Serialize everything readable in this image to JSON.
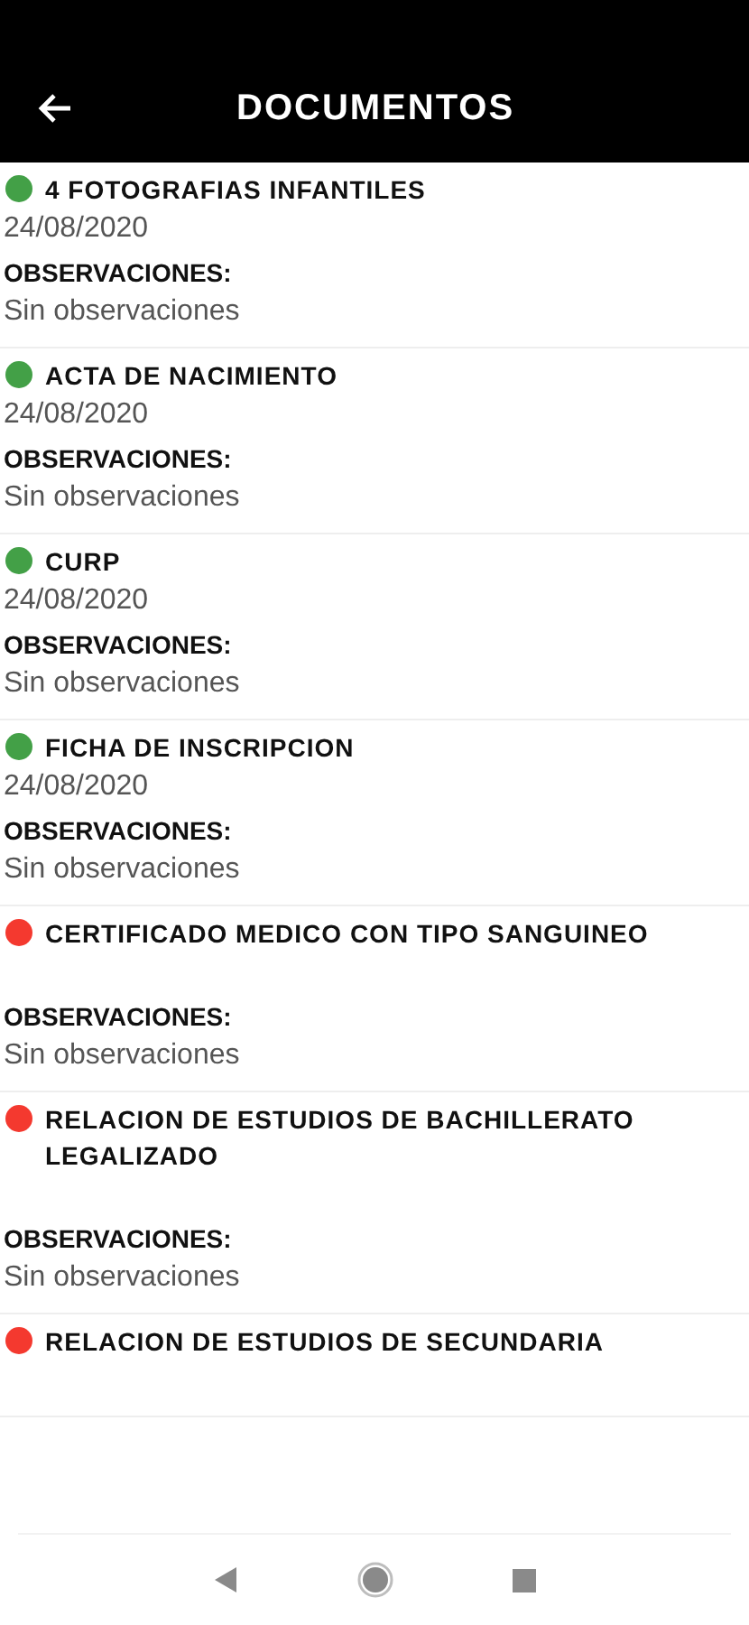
{
  "header": {
    "title": "DOCUMENTOS"
  },
  "documents": [
    {
      "name": "4 FOTOGRAFIAS INFANTILES",
      "color": "#43a047",
      "date": "24/08/2020",
      "observations_label": "OBSERVACIONES:",
      "observations": "Sin observaciones"
    },
    {
      "name": "ACTA DE NACIMIENTO",
      "color": "#43a047",
      "date": "24/08/2020",
      "observations_label": "OBSERVACIONES:",
      "observations": "Sin observaciones"
    },
    {
      "name": "CURP",
      "color": "#43a047",
      "date": "24/08/2020",
      "observations_label": "OBSERVACIONES:",
      "observations": "Sin observaciones"
    },
    {
      "name": "FICHA DE INSCRIPCION",
      "color": "#43a047",
      "date": "24/08/2020",
      "observations_label": "OBSERVACIONES:",
      "observations": "Sin observaciones"
    },
    {
      "name": "CERTIFICADO MEDICO CON TIPO SANGUINEO",
      "color": "#f4392f",
      "observations_label": "OBSERVACIONES:",
      "observations": "Sin observaciones"
    },
    {
      "name": "RELACION DE ESTUDIOS DE BACHILLERATO LEGALIZADO",
      "color": "#f4392f",
      "observations_label": "OBSERVACIONES:",
      "observations": "Sin observaciones"
    },
    {
      "name": "RELACION DE ESTUDIOS DE SECUNDARIA",
      "color": "#f4392f"
    }
  ]
}
